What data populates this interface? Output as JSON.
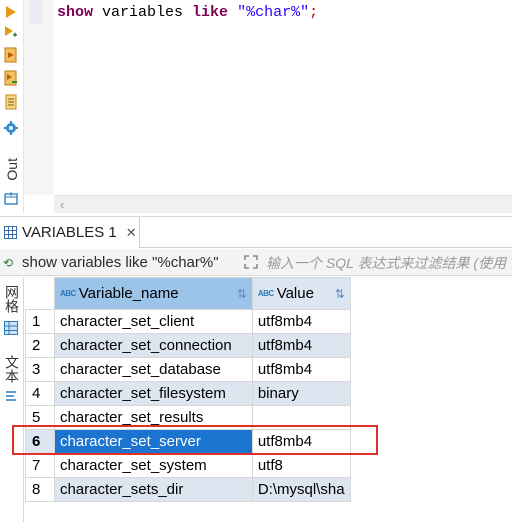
{
  "editor": {
    "keyword_show": "show",
    "word_variables": " variables ",
    "keyword_like": "like",
    "space": " ",
    "string_literal": "\"%char%\"",
    "semicolon": ";"
  },
  "toolbar": {
    "output_label": "Out"
  },
  "results_tab": {
    "label": "VARIABLES 1",
    "close": "✕"
  },
  "filter": {
    "query": "show variables like \"%char%\"",
    "placeholder": "输入一个 SQL 表达式来过滤结果 (使用"
  },
  "side_tabs": {
    "grid_label": "网格",
    "text_label": "文本"
  },
  "table": {
    "columns": [
      {
        "label": "Variable_name",
        "type_badge": "ABC"
      },
      {
        "label": "Value",
        "type_badge": "ABC"
      }
    ],
    "selected_row": 6,
    "rows": [
      {
        "num": "1",
        "name": "character_set_client",
        "value": "utf8mb4"
      },
      {
        "num": "2",
        "name": "character_set_connection",
        "value": "utf8mb4"
      },
      {
        "num": "3",
        "name": "character_set_database",
        "value": "utf8mb4"
      },
      {
        "num": "4",
        "name": "character_set_filesystem",
        "value": "binary"
      },
      {
        "num": "5",
        "name": "character_set_results",
        "value": ""
      },
      {
        "num": "6",
        "name": "character_set_server",
        "value": "utf8mb4"
      },
      {
        "num": "7",
        "name": "character_set_system",
        "value": "utf8"
      },
      {
        "num": "8",
        "name": "character_sets_dir",
        "value": "D:\\mysql\\sha"
      }
    ]
  },
  "colors": {
    "selection": "#1a74d0",
    "highlight_box": "#e0302a",
    "header_active": "#9cc3e8",
    "keyword": "#7f0055",
    "string": "#2a00ff"
  }
}
